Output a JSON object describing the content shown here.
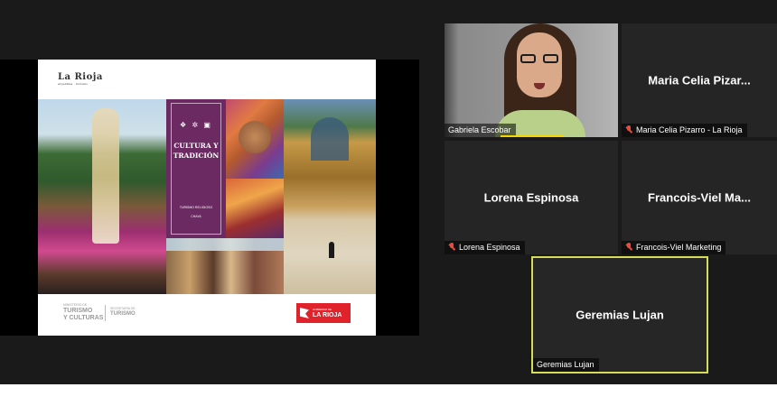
{
  "meeting": {
    "shared_slide": {
      "logo_text": "La Rioja",
      "logo_subtext": "argentina · turismo",
      "panel_icons": "❖ ✲ ▣",
      "panel_title": "CULTURA Y TRADICIÓN",
      "panel_subtitle": "TURISMO RELIGIOSO",
      "panel_subtitle2": "CHAYA",
      "ministry_line1": "TURISMO",
      "ministry_line2": "Y CULTURAS",
      "ministry_small": "MINISTERIO DE",
      "secretaria_small": "SECRETARÍA DE",
      "secretaria_line": "TURISMO",
      "gov_logo_small": "GOBIERNO DE",
      "gov_logo_big": "LA RIOJA"
    },
    "participants": [
      {
        "name": "Gabriela Escobar",
        "video_on": true,
        "active_speaker": true
      },
      {
        "name": "Maria Celia Pizar...",
        "label": "Maria Celia Pizarro - La Rioja",
        "muted": true
      },
      {
        "name": "Lorena Espinosa",
        "label": "Lorena Espinosa",
        "muted": true
      },
      {
        "name": "Francois-Viel  Ma...",
        "label": "Francois-Viel Marketing",
        "muted": true
      },
      {
        "name": "Geremias Lujan",
        "label": "Geremias Lujan",
        "highlighted": true
      }
    ]
  },
  "colors": {
    "background": "#1a1a1a",
    "tile": "#252525",
    "active_speaker": "#f5d600",
    "highlight_border": "#d6dc5a",
    "muted_icon": "#e74c3c",
    "slide_panel": "#6c2a63"
  },
  "icons": [
    "mic-muted-icon",
    "hand-icon",
    "flower-icon",
    "building-icon"
  ]
}
